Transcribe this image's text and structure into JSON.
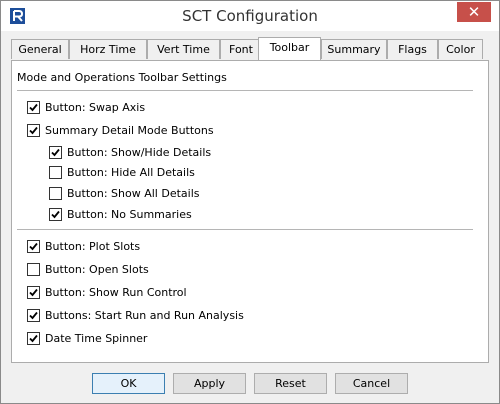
{
  "window": {
    "title": "SCT Configuration",
    "close_glyph": "✕",
    "app_icon": "R"
  },
  "tabs": [
    {
      "label": "General",
      "active": false
    },
    {
      "label": "Horz Time",
      "active": false
    },
    {
      "label": "Vert Time",
      "active": false
    },
    {
      "label": "Font",
      "active": false
    },
    {
      "label": "Toolbar",
      "active": true
    },
    {
      "label": "Summary",
      "active": false
    },
    {
      "label": "Flags",
      "active": false
    },
    {
      "label": "Color",
      "active": false
    }
  ],
  "panel": {
    "section_title": "Mode and Operations Toolbar Settings",
    "options": [
      {
        "label": "Button: Swap Axis",
        "checked": true
      },
      {
        "label": "Summary Detail Mode Buttons",
        "checked": true
      },
      {
        "label": "Button: Show/Hide Details",
        "checked": true
      },
      {
        "label": "Button: Hide All Details",
        "checked": false
      },
      {
        "label": "Button: Show All Details",
        "checked": false
      },
      {
        "label": "Button: No Summaries",
        "checked": true
      },
      {
        "label": "Button: Plot Slots",
        "checked": true
      },
      {
        "label": "Button: Open Slots",
        "checked": false
      },
      {
        "label": "Button: Show Run Control",
        "checked": true
      },
      {
        "label": "Buttons: Start Run and Run Analysis",
        "checked": true
      },
      {
        "label": "Date Time Spinner",
        "checked": true
      }
    ]
  },
  "buttons": {
    "ok": "OK",
    "apply": "Apply",
    "reset": "Reset",
    "cancel": "Cancel"
  },
  "colors": {
    "close": "#c7504a",
    "icon": "#1d4e9a"
  }
}
